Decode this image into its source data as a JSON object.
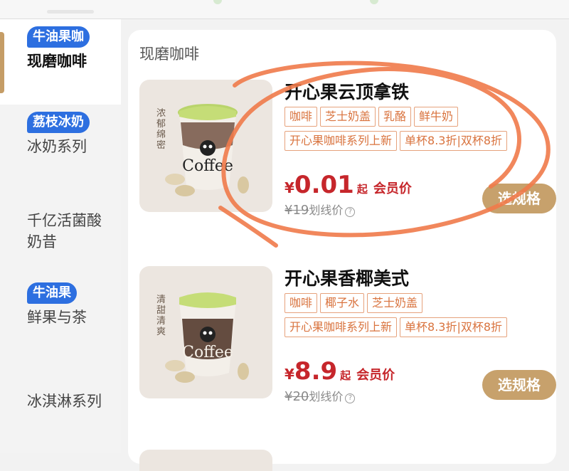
{
  "sidebar": {
    "items": [
      {
        "badge": "牛油果咖",
        "label": "现磨咖啡",
        "active": true
      },
      {
        "badge": "荔枝冰奶",
        "label": "冰奶系列",
        "active": false
      },
      {
        "badge": "",
        "label_line1": "千亿活菌酸",
        "label_line2": "奶昔",
        "active": false
      },
      {
        "badge": "牛油果",
        "label": "鲜果与茶",
        "active": false
      },
      {
        "badge": "",
        "label": "冰淇淋系列",
        "active": false
      }
    ]
  },
  "main": {
    "section_title": "现磨咖啡",
    "products": [
      {
        "name": "开心果云顶拿铁",
        "tags_row1": [
          "咖啡",
          "芝士奶盖",
          "乳酪",
          "鲜牛奶"
        ],
        "tags_row2": [
          "开心果咖啡系列上新",
          "单杯8.3折|双杯8折"
        ],
        "price_symbol": "¥",
        "price": "0.01",
        "price_suffix": "起",
        "member_label": "会员价",
        "original_price": "¥19",
        "original_label": "划线价",
        "button_label": "选规格",
        "thumb_text": "浓郁绵密",
        "cup_label": "Coffee"
      },
      {
        "name": "开心果香椰美式",
        "tags_row1": [
          "咖啡",
          "椰子水",
          "芝士奶盖"
        ],
        "tags_row2": [
          "开心果咖啡系列上新",
          "单杯8.3折|双杯8折"
        ],
        "price_symbol": "¥",
        "price": "8.9",
        "price_suffix": "起",
        "member_label": "会员价",
        "original_price": "¥20",
        "original_label": "划线价",
        "button_label": "选规格",
        "thumb_text": "清甜清爽",
        "cup_label": "Coffee"
      }
    ]
  },
  "colors": {
    "accent_gold": "#c7a16c",
    "price_red": "#c6262b",
    "tag_orange": "#d9733e",
    "badge_blue": "#2d6fe0",
    "scribble": "#f07a4a"
  },
  "icons": [
    "info-icon",
    "cup-image",
    "scribble-annotation"
  ]
}
